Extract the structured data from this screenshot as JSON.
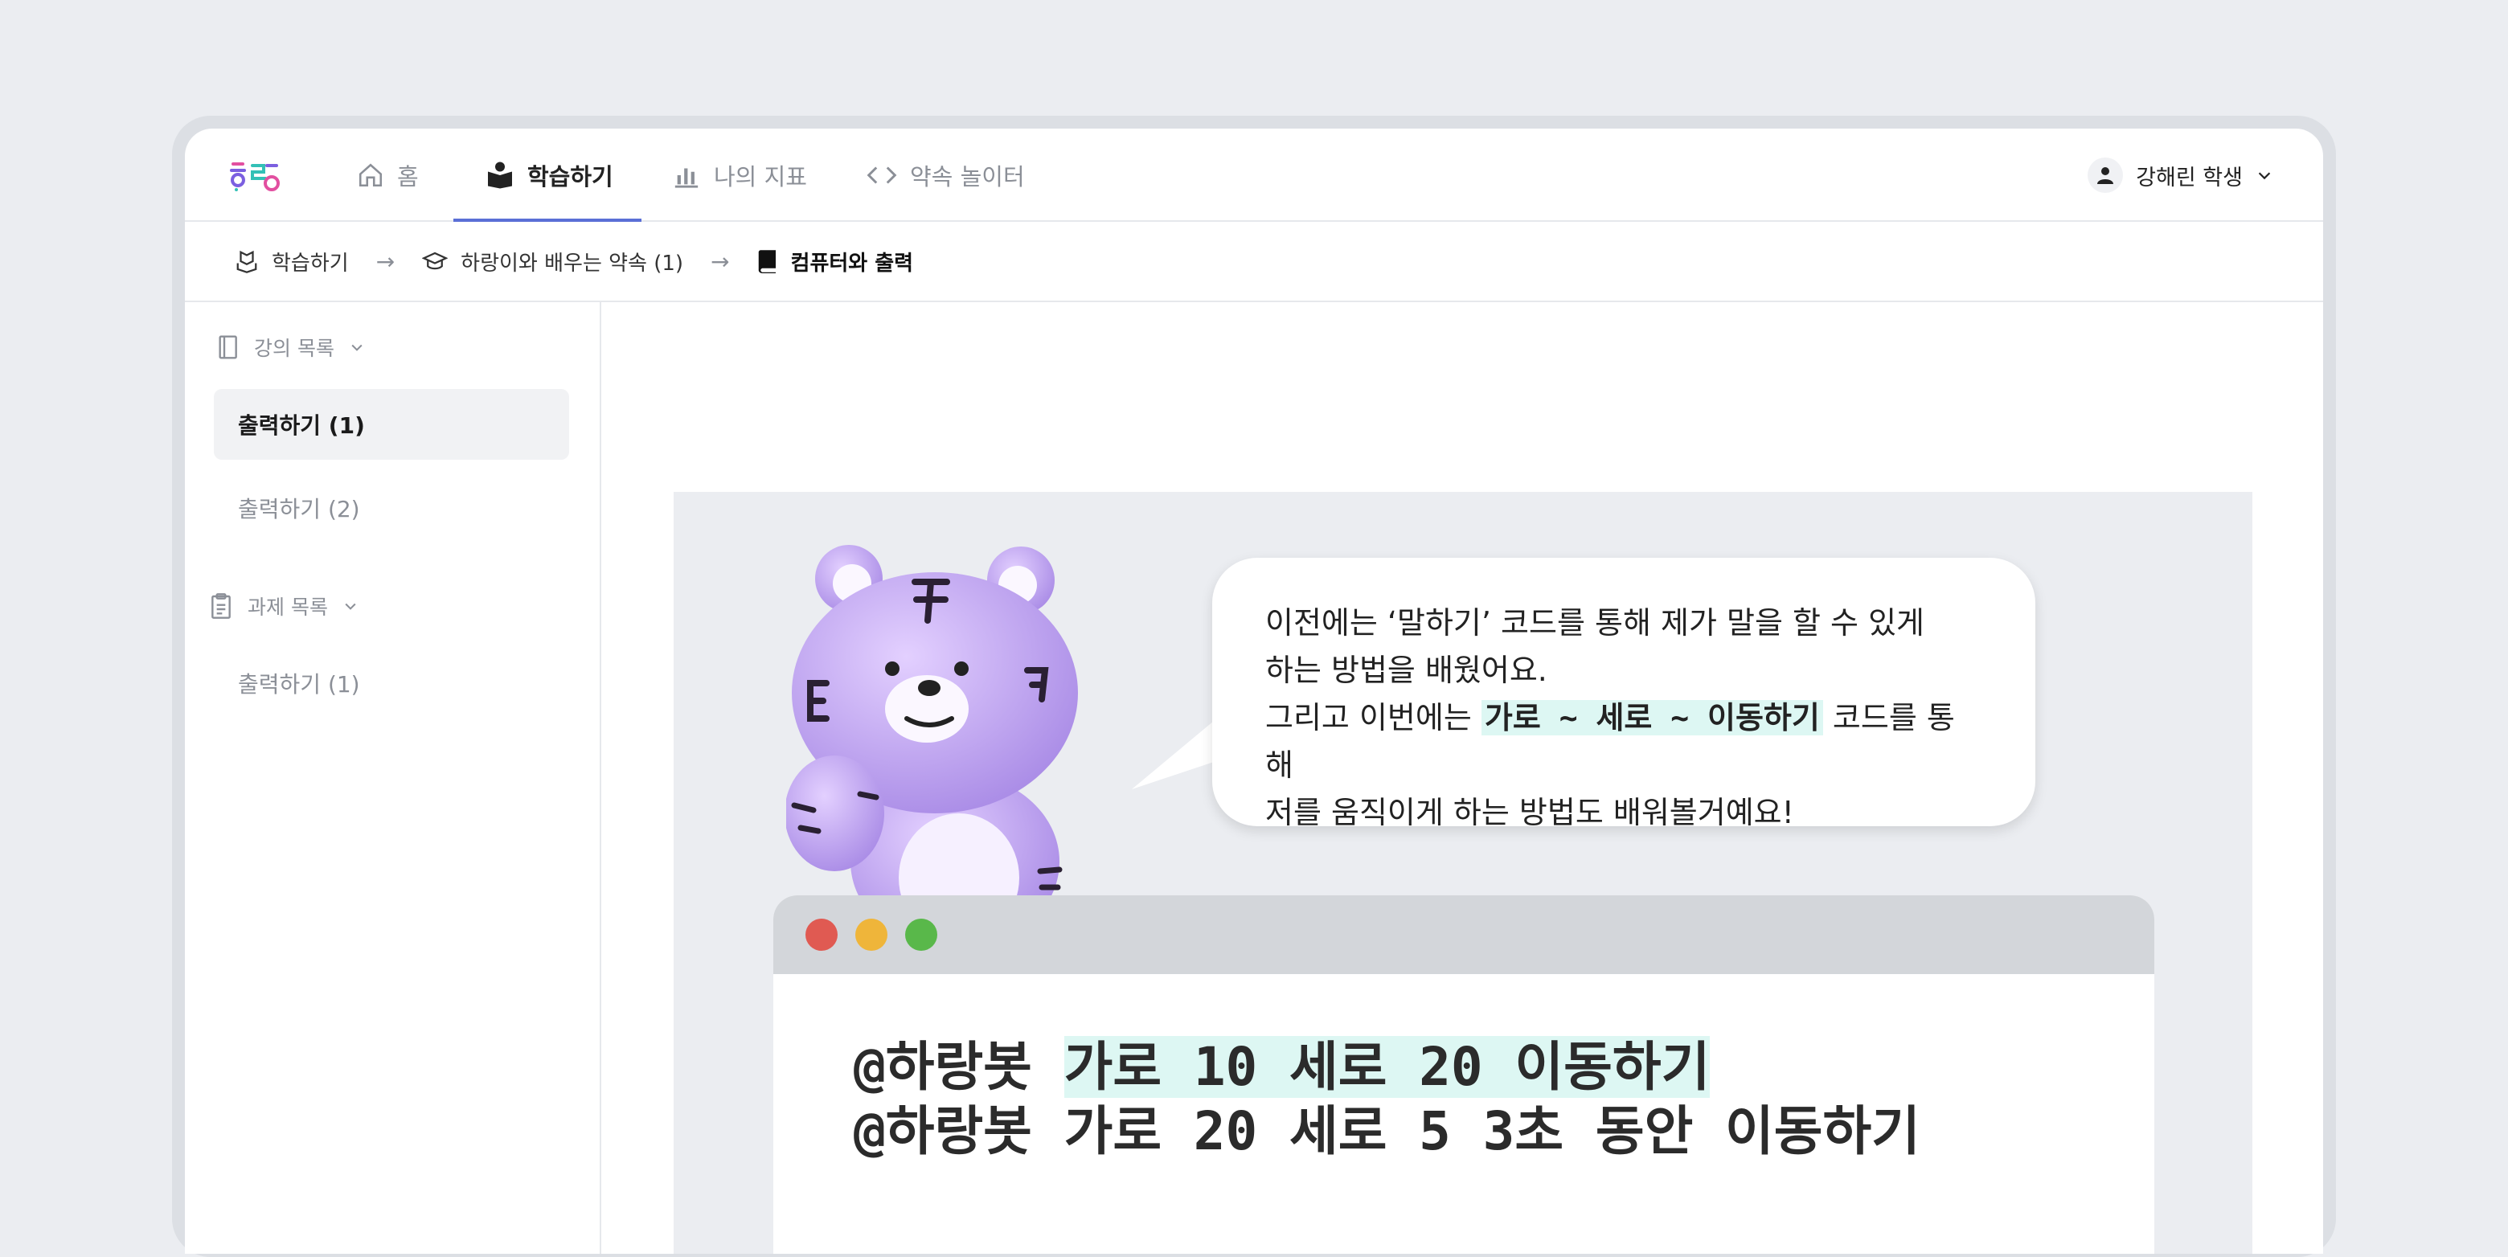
{
  "nav": {
    "items": [
      {
        "label": "홈",
        "icon": "home-icon"
      },
      {
        "label": "학습하기",
        "icon": "book-reader-icon",
        "active": true
      },
      {
        "label": "나의 지표",
        "icon": "bar-chart-icon"
      },
      {
        "label": "약속 놀이터",
        "icon": "code-icon"
      }
    ],
    "active_color": "#5b6fd6"
  },
  "user": {
    "name": "강해린 학생"
  },
  "breadcrumb": {
    "items": [
      "학습하기",
      "하랑이와 배우는 약속 (1)",
      "컴퓨터와 출력"
    ]
  },
  "sidebar": {
    "lectures_title": "강의 목록",
    "lectures": [
      "출력하기 (1)",
      "출력하기 (2)"
    ],
    "selected_lecture": "출력하기 (1)",
    "tasks_title": "과제 목록",
    "tasks": [
      "출력하기 (1)"
    ]
  },
  "lesson": {
    "bubble": {
      "line1": "이전에는 ‘말하기’ 코드를 통해 제가 말을 할 수 있게",
      "line2": "하는 방법을 배웠어요.",
      "line3_before": "그리고 이번에는 ",
      "line3_code": "가로 ~ 세로 ~ 이동하기",
      "line3_after": " 코드를 통해",
      "line4": "저를 움직이게 하는 방법도 배워볼거예요!"
    },
    "code": {
      "line1_prefix": "@하랑봇 ",
      "line1_highlight": "가로 10 세로 20 이동하기",
      "line2": "@하랑봇 가로 20 세로 5 3초 동안 이동하기"
    },
    "window_dots": [
      "#e05a52",
      "#efb53a",
      "#59b84a"
    ],
    "highlight_color": "#ddf7f3"
  }
}
